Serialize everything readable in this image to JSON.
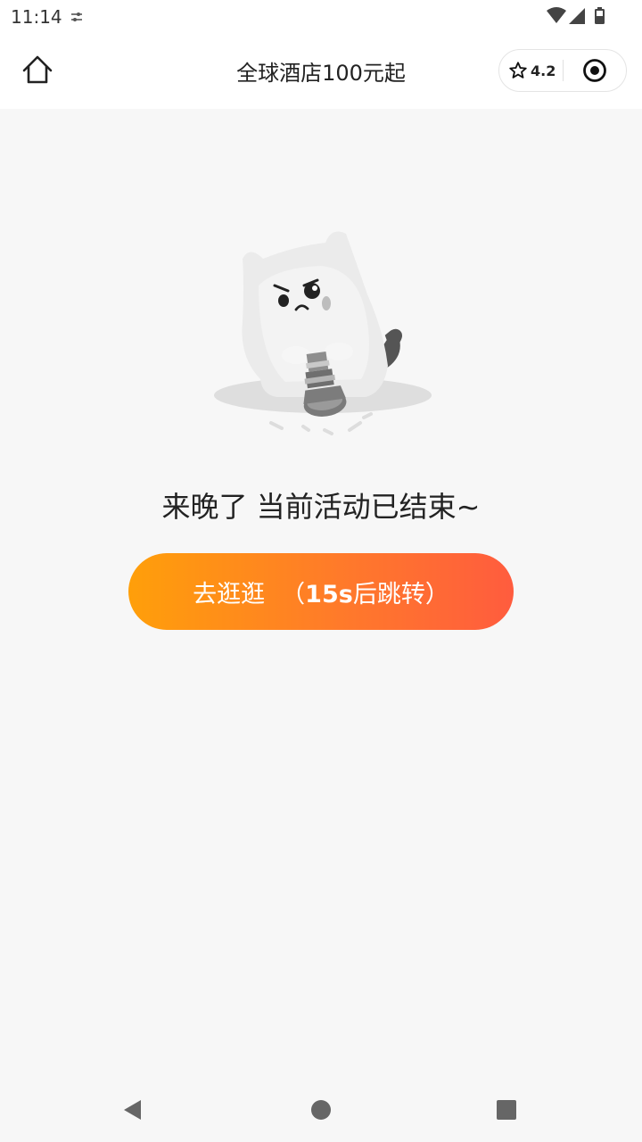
{
  "status_bar": {
    "time": "11:14",
    "icons": [
      "settings-icon",
      "wifi-icon",
      "signal-icon",
      "battery-icon"
    ]
  },
  "header": {
    "title": "全球酒店100元起",
    "rating": "4.2",
    "icons": [
      "home-icon",
      "star-icon",
      "target-icon"
    ]
  },
  "main": {
    "illustration": "sad-cat-with-telescope",
    "message": "来晚了 当前活动已结束~",
    "button": {
      "label": "去逛逛",
      "countdown_open": "（",
      "countdown_seconds": "15s",
      "countdown_text": "后跳转）"
    }
  },
  "nav_bar": {
    "icons": [
      "back-icon",
      "home-circle-icon",
      "recents-icon"
    ]
  },
  "colors": {
    "button_start": "#ff9f0a",
    "button_end": "#ff5c3e",
    "background": "#f7f7f7",
    "header_bg": "#ffffff"
  }
}
